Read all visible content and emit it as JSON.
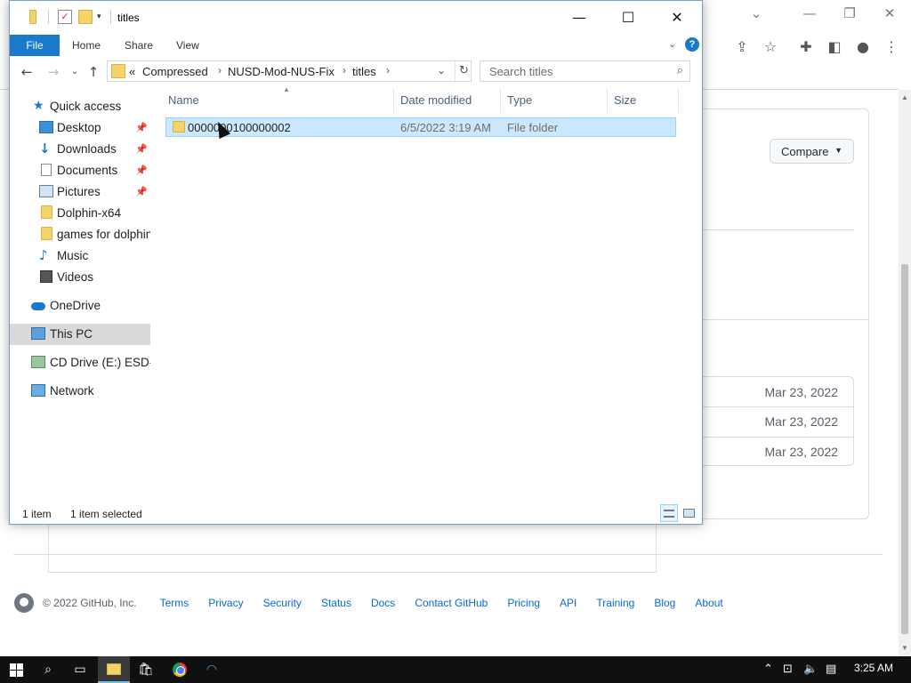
{
  "explorer": {
    "title": "titles",
    "ribbon": {
      "file": "File",
      "home": "Home",
      "share": "Share",
      "view": "View"
    },
    "breadcrumb": {
      "prefix": "«",
      "items": [
        "Compressed",
        "NUSD-Mod-NUS-Fix",
        "titles"
      ]
    },
    "search": {
      "placeholder": "Search titles"
    },
    "nav": {
      "quick_access": "Quick access",
      "items": [
        {
          "label": "Desktop",
          "pinned": true
        },
        {
          "label": "Downloads",
          "pinned": true
        },
        {
          "label": "Documents",
          "pinned": true
        },
        {
          "label": "Pictures",
          "pinned": true
        },
        {
          "label": "Dolphin-x64",
          "pinned": false
        },
        {
          "label": "games for dolphin",
          "pinned": false
        },
        {
          "label": "Music",
          "pinned": false
        },
        {
          "label": "Videos",
          "pinned": false
        }
      ],
      "onedrive": "OneDrive",
      "this_pc": "This PC",
      "cd_drive": "CD Drive (E:) ESD-",
      "network": "Network"
    },
    "columns": {
      "name": "Name",
      "date": "Date modified",
      "type": "Type",
      "size": "Size"
    },
    "files": [
      {
        "name": "0000000100000002",
        "date": "6/5/2022 3:19 AM",
        "type": "File folder",
        "size": ""
      }
    ],
    "status": {
      "count": "1 item",
      "selected": "1 item selected"
    }
  },
  "github": {
    "compare_label": "Compare",
    "dates": [
      "Mar 23, 2022",
      "Mar 23, 2022",
      "Mar 23, 2022"
    ],
    "footer": {
      "copyright": "© 2022 GitHub, Inc.",
      "links": [
        "Terms",
        "Privacy",
        "Security",
        "Status",
        "Docs",
        "Contact GitHub",
        "Pricing",
        "API",
        "Training",
        "Blog",
        "About"
      ]
    }
  },
  "taskbar": {
    "time": "3:25 AM"
  },
  "icons": {
    "pin": "pin-icon",
    "folder": "folder-icon",
    "search": "search-icon"
  },
  "colors": {
    "accent": "#1979ca",
    "selection": "#cce8ff",
    "link": "#0969da"
  }
}
